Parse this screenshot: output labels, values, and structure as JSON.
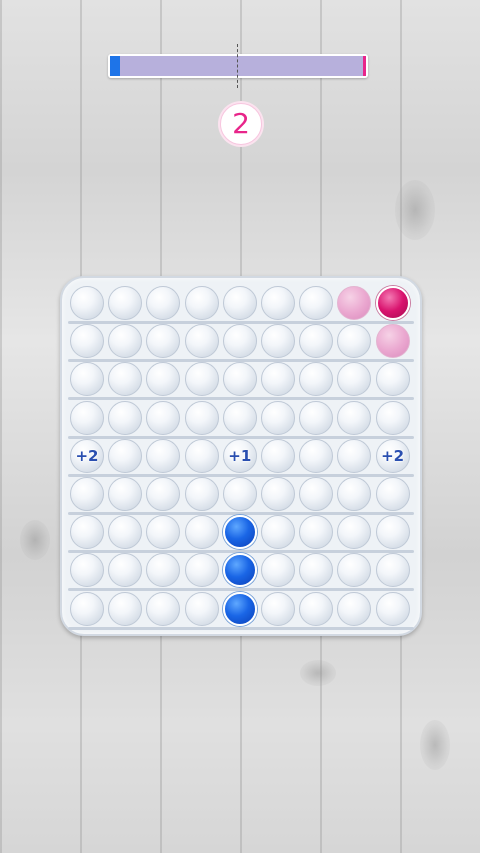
{
  "score": "2",
  "progress": {
    "blue_fraction": 0.04,
    "pink_fraction": 0.01,
    "divider_fraction": 0.5
  },
  "colors": {
    "blue": "#1a66e6",
    "pink": "#e8258a",
    "track": "#b7b0dc",
    "board": "#eef2f6"
  },
  "board": {
    "rows": 9,
    "cols": 9,
    "grid": [
      [
        "e",
        "e",
        "e",
        "e",
        "e",
        "e",
        "e",
        "pl",
        "pd"
      ],
      [
        "e",
        "e",
        "e",
        "e",
        "e",
        "e",
        "e",
        "e",
        "pl"
      ],
      [
        "e",
        "e",
        "e",
        "e",
        "e",
        "e",
        "e",
        "e",
        "e"
      ],
      [
        "e",
        "e",
        "e",
        "e",
        "e",
        "e",
        "e",
        "e",
        "e"
      ],
      [
        "e",
        "e",
        "e",
        "e",
        "e",
        "e",
        "e",
        "e",
        "e"
      ],
      [
        "e",
        "e",
        "e",
        "e",
        "e",
        "e",
        "e",
        "e",
        "e"
      ],
      [
        "e",
        "e",
        "e",
        "e",
        "b",
        "e",
        "e",
        "e",
        "e"
      ],
      [
        "e",
        "e",
        "e",
        "e",
        "b",
        "e",
        "e",
        "e",
        "e"
      ],
      [
        "e",
        "e",
        "e",
        "e",
        "b",
        "e",
        "e",
        "e",
        "e"
      ]
    ],
    "bonuses": [
      {
        "row": 4,
        "col": 0,
        "label": "+2"
      },
      {
        "row": 4,
        "col": 4,
        "label": "+1"
      },
      {
        "row": 4,
        "col": 8,
        "label": "+2"
      }
    ]
  }
}
